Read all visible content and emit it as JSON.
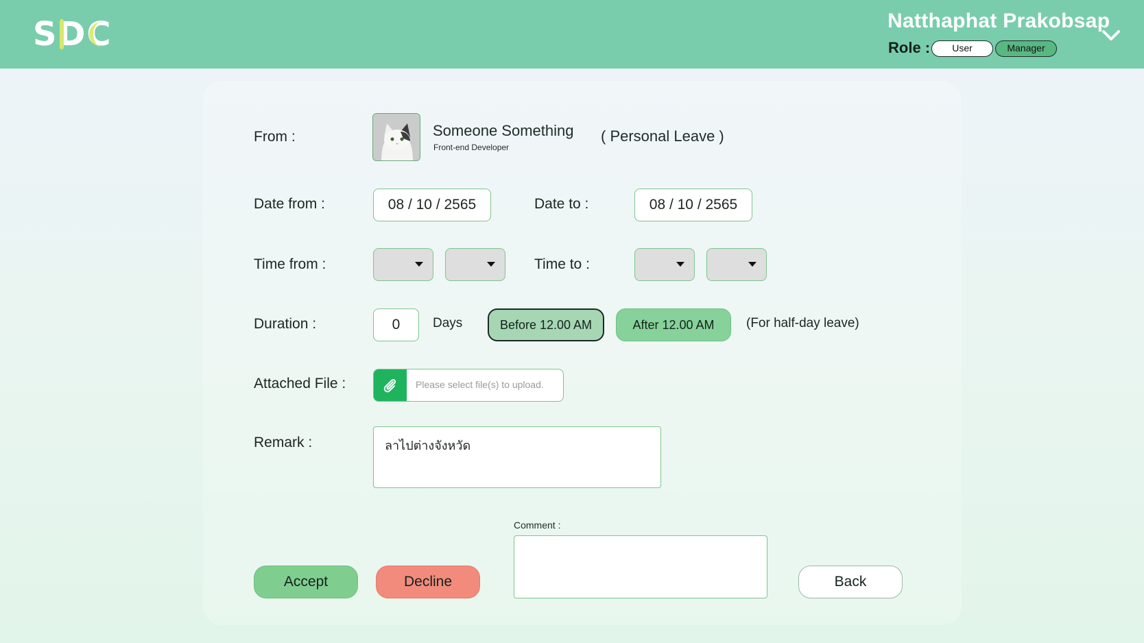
{
  "header": {
    "logo_text": "SDC",
    "user_name": "Natthaphat Prakobsap",
    "role_label": "Role :",
    "roles": [
      "User",
      "Manager"
    ],
    "active_role": "Manager",
    "menu_icon": "chevron-down-icon"
  },
  "form": {
    "from_label": "From :",
    "employee": {
      "name": "Someone Something",
      "position": "Front-end Developer",
      "avatar_icon": "cat-avatar"
    },
    "leave_type": "( Personal Leave )",
    "date_from_label": "Date from :",
    "date_from_value": "08 / 10 / 2565",
    "date_to_label": "Date to :",
    "date_to_value": "08 / 10 / 2565",
    "time_from_label": "Time from :",
    "time_to_label": "Time to :",
    "duration_label": "Duration :",
    "duration_value": "0",
    "duration_unit": "Days",
    "half_day_options": [
      "Before 12.00 AM",
      "After 12.00 AM"
    ],
    "selected_half_day": "Before 12.00 AM",
    "half_day_note": "(For half-day leave)",
    "attached_file_label": "Attached File :",
    "attached_file_placeholder": "Please select file(s) to upload.",
    "remark_label": "Remark :",
    "remark_value": "ลาไปต่างจังหวัด",
    "comment_label": "Comment :",
    "comment_value": ""
  },
  "actions": {
    "accept": "Accept",
    "decline": "Decline",
    "back": "Back"
  },
  "colors": {
    "header_bg": "#79cdac",
    "accept": "#7fce8f",
    "decline": "#f28b7b",
    "attach": "#1fb35e",
    "manager_role": "#59b882"
  }
}
